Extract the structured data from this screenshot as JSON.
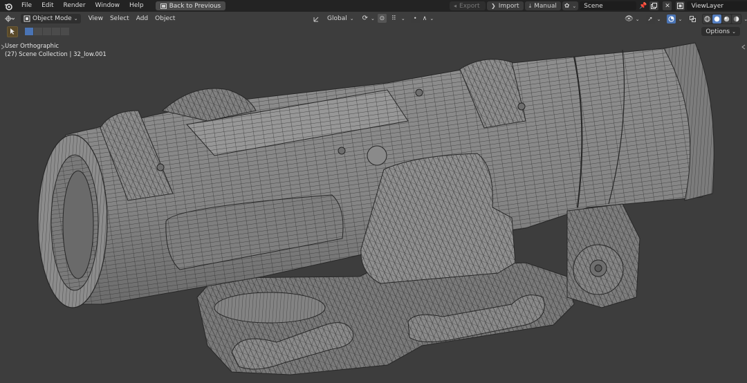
{
  "menu": {
    "items": [
      "File",
      "Edit",
      "Render",
      "Window",
      "Help"
    ],
    "back_button": "Back to Previous"
  },
  "topbar_right": {
    "export_label": "Export",
    "import_label": "Import",
    "manual_label": "Manual",
    "scene_name": "Scene",
    "view_layer": "ViewLayer"
  },
  "viewport_header": {
    "mode": "Object Mode",
    "menus": [
      "View",
      "Select",
      "Add",
      "Object"
    ],
    "transform_orientation": "Global",
    "options_label": "Options"
  },
  "overlay": {
    "view_name": "User Orthographic",
    "collection_info": "(27) Scene Collection | 32_low.001"
  },
  "colors": {
    "ui_dark": "#232323",
    "viewport_bg": "#3d3d3d",
    "mesh_fill": "#8a8a8a",
    "wire": "#2c2c2c",
    "active_tool": "#5a4a2a",
    "select_blue": "#4a74b5"
  },
  "icons": [
    "blender-logo-icon",
    "back-icon",
    "export-icon",
    "import-icon",
    "manual-icon",
    "scene-icon",
    "pin-icon",
    "new-scene-icon",
    "viewlayer-icon",
    "new-layer-icon",
    "editor-type-icon",
    "object-mode-icon",
    "orientation-icon",
    "pivot-icon",
    "snap-icon",
    "proportional-icon",
    "visibility-icon",
    "gizmo-icon",
    "overlay-icon",
    "xray-icon",
    "wireframe-shade-icon",
    "solid-shade-icon",
    "material-shade-icon",
    "rendered-shade-icon",
    "select-tool-icon"
  ]
}
